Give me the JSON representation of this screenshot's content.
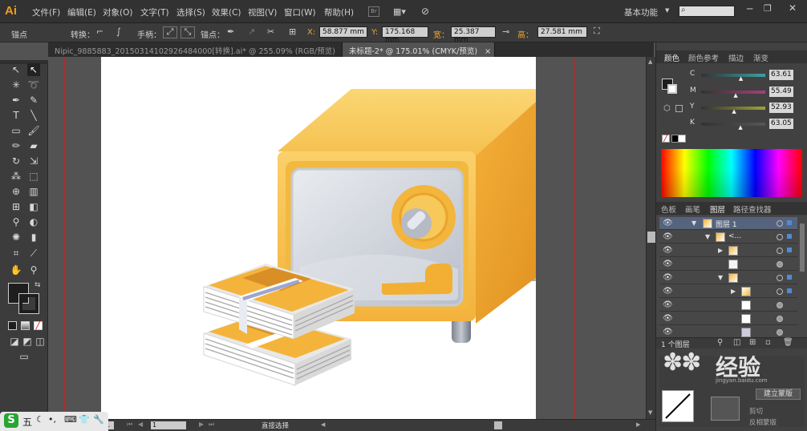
{
  "app": {
    "logo": "Ai"
  },
  "menu": {
    "items": [
      "文件(F)",
      "编辑(E)",
      "对象(O)",
      "文字(T)",
      "选择(S)",
      "效果(C)",
      "视图(V)",
      "窗口(W)",
      "帮助(H)"
    ],
    "br_label": "Br",
    "workspace": "基本功能",
    "search_placeholder": ""
  },
  "control": {
    "anchor_label": "锚点",
    "convert_label": "转换：",
    "handle_label": "手柄：",
    "anchors_label": "锚点：",
    "x_label": "X:",
    "x_value": "58.877",
    "y_label": "Y:",
    "y_value": "175.168",
    "w_label": "宽：",
    "w_value": "25.387",
    "h_label": "高：",
    "h_value": "27.581",
    "unit": "mm"
  },
  "tabs": [
    {
      "label": "Nipic_9885883_20150314102926484000[转换].ai* @ 255.09% (RGB/预览)"
    },
    {
      "label": "未标题-2* @ 175.01% (CMYK/预览)"
    }
  ],
  "tab_close": "×",
  "status": {
    "zoom": "1",
    "page": "1",
    "tool": "直接选择"
  },
  "color_panel": {
    "tabs": [
      "颜色",
      "颜色参考",
      "描边",
      "渐变"
    ],
    "channels": [
      {
        "label": "C",
        "value": "63.61",
        "level": 0.636,
        "color": "#3d9fa3"
      },
      {
        "label": "M",
        "value": "55.49",
        "level": 0.555,
        "color": "#a83e7c"
      },
      {
        "label": "Y",
        "value": "52.93",
        "level": 0.529,
        "color": "#a2a236"
      },
      {
        "label": "K",
        "value": "63.05",
        "level": 0.63,
        "color": "#555555"
      }
    ]
  },
  "layers_panel": {
    "tabs": [
      "色板",
      "画笔",
      "图层",
      "路径查找器"
    ],
    "top_layer": "图层 1",
    "group_label": "<...",
    "footer_count": "1 个图层"
  },
  "colors": {
    "accent": "#f29b22",
    "artboard": "#ffffff",
    "bg": "#535353"
  },
  "watermark": {
    "text": "经验",
    "sub": "jingyan.baidu.com"
  },
  "bottom_mini": {
    "labels": [
      "剪切",
      "反相蒙版"
    ],
    "button": "建立蒙版"
  },
  "taskbar": {
    "ime_label": "五"
  }
}
